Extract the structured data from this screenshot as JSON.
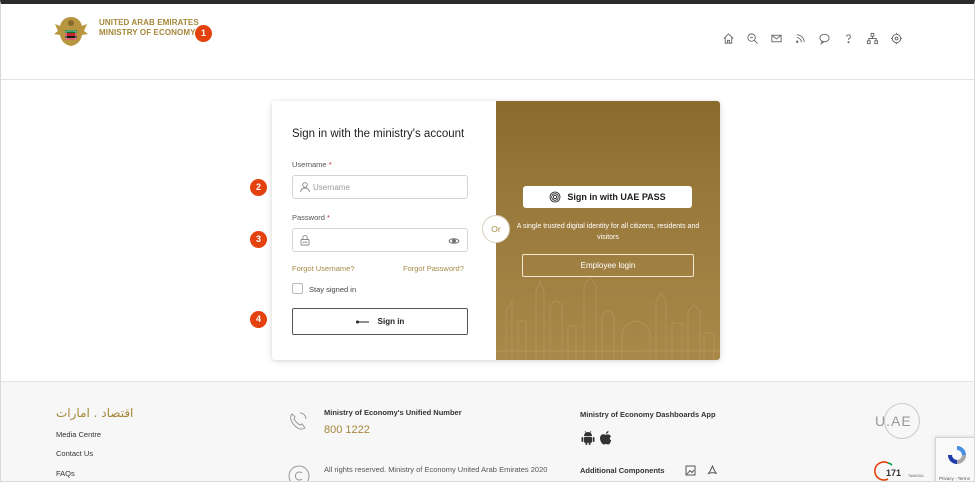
{
  "header": {
    "org_line1": "UNITED ARAB EMIRATES",
    "org_line2": "MINISTRY OF ECONOMY",
    "icons": [
      "home-icon",
      "search-icon",
      "mail-icon",
      "rss-icon",
      "chat-icon",
      "help-icon",
      "sitemap-icon",
      "accessibility-icon"
    ]
  },
  "badges": [
    "1",
    "2",
    "3",
    "4"
  ],
  "login": {
    "title": "Sign in with the ministry's account",
    "username_label": "Username",
    "username_placeholder": "Username",
    "password_label": "Password",
    "required_mark": "*",
    "forgot_username": "Forgot Username?",
    "forgot_password": "Forgot Password?",
    "stay_signed_in": "Stay signed in",
    "sign_in": "Sign in",
    "or": "Or"
  },
  "uaepass": {
    "button": "Sign in with UAE PASS",
    "description": "A single trusted digital identity for all citizens, residents and visitors",
    "employee_login": "Employee login"
  },
  "footer": {
    "arabic_logo": "اقتصاد . امارات",
    "links": [
      "Media Centre",
      "Contact Us",
      "FAQs"
    ],
    "unified_title": "Ministry of Economy's Unified Number",
    "unified_number": "800 1222",
    "copyright": "All rights reserved. Ministry of Economy United Arab Emirates 2020",
    "dashboards_title": "Ministry of Economy Dashboards App",
    "additional_components": "Additional Components",
    "uae_brand": "U.AE",
    "tawasul_number": "171",
    "tawasul_label": "TAWASUL",
    "recaptcha_text": "Privacy - Terms"
  },
  "colors": {
    "gold": "#a5873a",
    "badge": "#e3420e",
    "panel": "#9a7a3c"
  }
}
